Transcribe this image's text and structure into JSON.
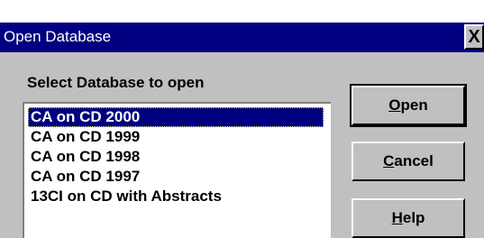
{
  "window": {
    "title": "Open Database",
    "close_glyph": "X"
  },
  "prompt_label": "Select Database to open",
  "databases": [
    {
      "label": "CA on CD 2000",
      "selected": true
    },
    {
      "label": "CA on CD 1999",
      "selected": false
    },
    {
      "label": "CA on CD 1998",
      "selected": false
    },
    {
      "label": "CA on CD 1997",
      "selected": false
    },
    {
      "label": "13CI on CD with Abstracts",
      "selected": false
    }
  ],
  "buttons": {
    "open": {
      "mnemonic": "O",
      "rest": "pen"
    },
    "cancel": {
      "mnemonic": "C",
      "rest": "ancel"
    },
    "help": {
      "mnemonic": "H",
      "rest": "elp"
    }
  },
  "colors": {
    "titlebar": "#000080",
    "selection": "#000080",
    "face": "#c0c0c0"
  }
}
